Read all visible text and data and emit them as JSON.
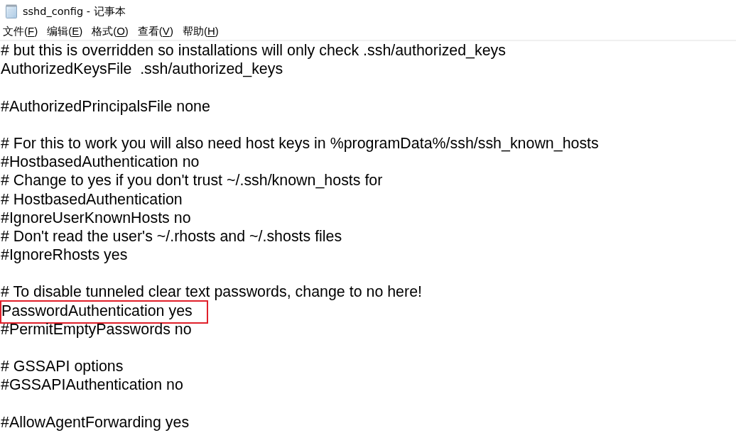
{
  "window": {
    "title": "sshd_config - 记事本"
  },
  "menu": [
    {
      "text": "文件(",
      "access_key": "F",
      "suffix": ")"
    },
    {
      "text": "编辑(",
      "access_key": "E",
      "suffix": ")"
    },
    {
      "text": "格式(",
      "access_key": "O",
      "suffix": ")"
    },
    {
      "text": "查看(",
      "access_key": "V",
      "suffix": ")"
    },
    {
      "text": "帮助(",
      "access_key": "H",
      "suffix": ")"
    }
  ],
  "editor": {
    "blocks": [
      {
        "lines": [
          {
            "text": "# but this is overridden so installations will only check .ssh/authorized_keys",
            "highlighted": false
          },
          {
            "text": "AuthorizedKeysFile  .ssh/authorized_keys",
            "highlighted": false
          }
        ]
      },
      {
        "lines": [
          {
            "text": "#AuthorizedPrincipalsFile none",
            "highlighted": false
          }
        ]
      },
      {
        "lines": [
          {
            "text": "# For this to work you will also need host keys in %programData%/ssh/ssh_known_hosts",
            "highlighted": false
          },
          {
            "text": "#HostbasedAuthentication no",
            "highlighted": false
          },
          {
            "text": "# Change to yes if you don't trust ~/.ssh/known_hosts for",
            "highlighted": false
          },
          {
            "text": "# HostbasedAuthentication",
            "highlighted": false
          },
          {
            "text": "#IgnoreUserKnownHosts no",
            "highlighted": false
          },
          {
            "text": "# Don't read the user's ~/.rhosts and ~/.shosts files",
            "highlighted": false
          },
          {
            "text": "#IgnoreRhosts yes",
            "highlighted": false
          }
        ]
      },
      {
        "lines": [
          {
            "text": "# To disable tunneled clear text passwords, change to no here!",
            "highlighted": false
          },
          {
            "text": "PasswordAuthentication yes",
            "highlighted": true
          },
          {
            "text": "#PermitEmptyPasswords no",
            "highlighted": false
          }
        ]
      },
      {
        "lines": [
          {
            "text": "# GSSAPI options",
            "highlighted": false
          },
          {
            "text": "#GSSAPIAuthentication no",
            "highlighted": false
          }
        ]
      },
      {
        "lines": [
          {
            "text": "#AllowAgentForwarding yes",
            "highlighted": false
          }
        ]
      }
    ]
  }
}
